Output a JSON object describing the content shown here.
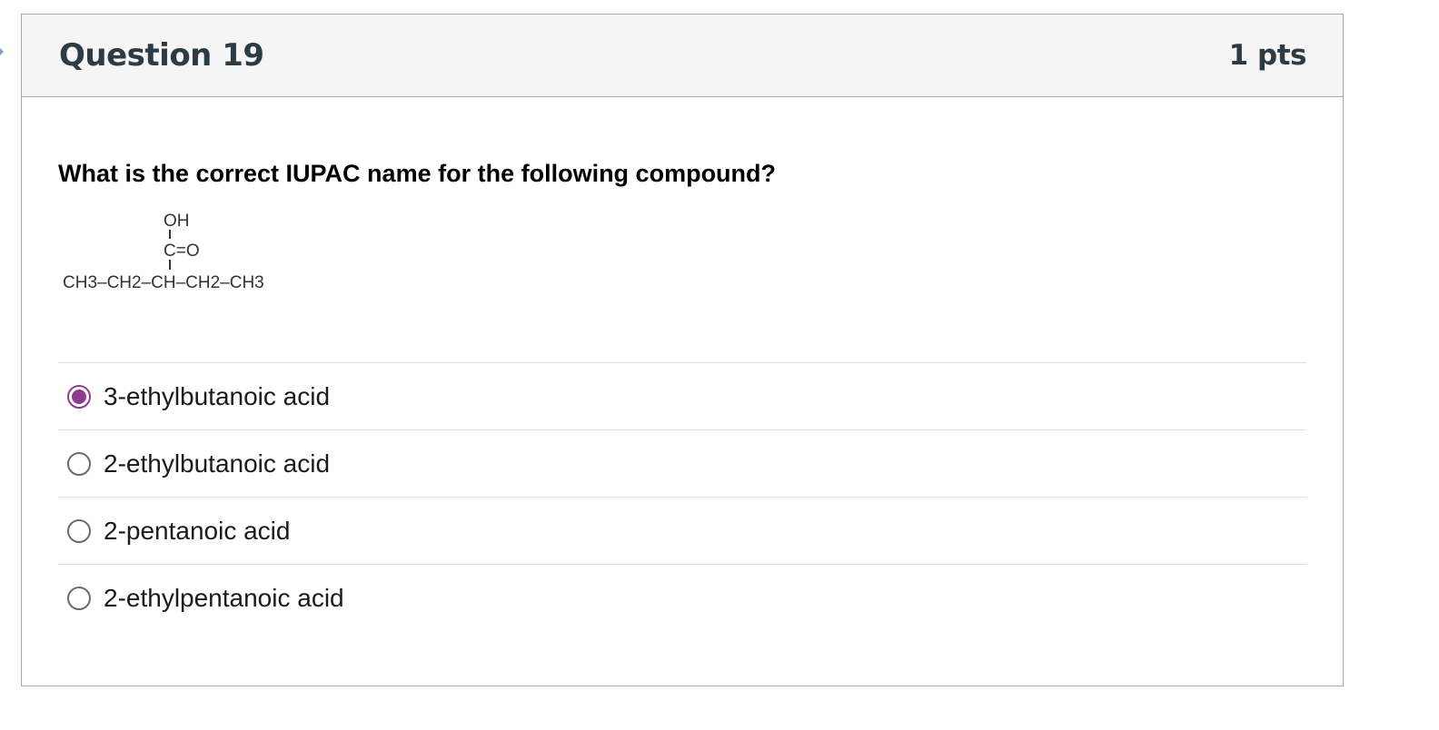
{
  "question": {
    "title": "Question 19",
    "points": "1 pts",
    "text": "What is the correct IUPAC name for the following compound?"
  },
  "structure": {
    "oh": "OH",
    "co": "C=O",
    "chain": "CH3–CH2–CH–CH2–CH3"
  },
  "answers": [
    {
      "label": "3-ethylbutanoic acid",
      "selected": true
    },
    {
      "label": "2-ethylbutanoic acid",
      "selected": false
    },
    {
      "label": "2-pentanoic acid",
      "selected": false
    },
    {
      "label": "2-ethylpentanoic acid",
      "selected": false
    }
  ],
  "colors": {
    "header_bg": "#f5f5f5",
    "border": "#a5a9ad",
    "title_text": "#2d3b45",
    "selected_radio": "#8e3c8e",
    "divider": "#dcdee0"
  }
}
